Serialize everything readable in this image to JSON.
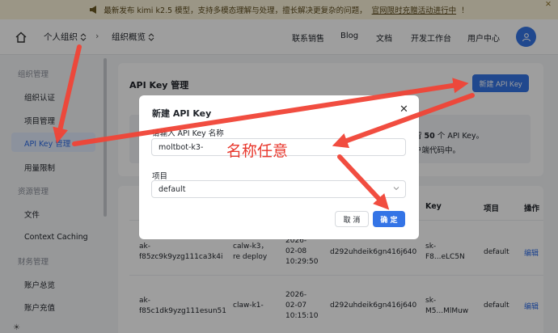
{
  "banner": {
    "text": "最新发布 kimi k2.5 模型，支持多模态理解与处理，擅长解决更复杂的问题，",
    "link": "官网限时充赠活动进行中",
    "suffix": "！"
  },
  "topbar": {
    "org": "个人组织",
    "page": "组织概览",
    "nav": [
      "联系销售",
      "Blog",
      "文档",
      "开发工作台",
      "用户中心"
    ]
  },
  "sidebar": {
    "section_org": "组织管理",
    "org_items": [
      "组织认证",
      "项目管理",
      "API Key 管理",
      "用量限制"
    ],
    "section_res": "资源管理",
    "res_items": [
      "文件",
      "Context Caching"
    ],
    "section_fin": "财务管理",
    "fin_items": [
      "账户总览",
      "账户充值"
    ]
  },
  "main": {
    "title": "API Key 管理",
    "new_button": "新建 API Key",
    "info_line1_pre": "留",
    "info_line1_num": "50",
    "info_line1_post": "个 API Key。",
    "info_line2": "户端代码中。",
    "table": {
      "headers": [
        "Key",
        "项目",
        "操作"
      ],
      "rows": [
        {
          "id_1": "ak-",
          "id_2": "f85zc9k9yzg111ca3k4i",
          "name_1": "calw-k3，",
          "name_2": "re deploy",
          "date_1": "2026-",
          "date_2": "02-08",
          "date_3": "10:29:50",
          "owner": "d292uhdeik6gn416j640",
          "key_1": "sk-",
          "key_2": "F8...eLC5N",
          "project": "default",
          "action": "编辑"
        },
        {
          "id_1": "ak-",
          "id_2": "f85c1dk9yzg111esun51",
          "name_1": "claw-k1-",
          "name_2": "",
          "date_1": "2026-",
          "date_2": "02-07",
          "date_3": "10:15:10",
          "owner": "d292uhdeik6gn416j640",
          "key_1": "sk-",
          "key_2": "M5...MlMuw",
          "project": "default",
          "action": "编辑"
        }
      ]
    }
  },
  "modal": {
    "title": "新建 API Key",
    "name_label": "请输入 API Key 名称",
    "name_value": "moltbot-k3-",
    "project_label": "项目",
    "project_value": "default",
    "cancel": "取 消",
    "confirm": "确 定"
  },
  "annotation": {
    "text": "名称任意",
    "color": "#e8372c"
  },
  "colors": {
    "accent": "#3474e6",
    "banner_bg": "#fbf3d9"
  }
}
